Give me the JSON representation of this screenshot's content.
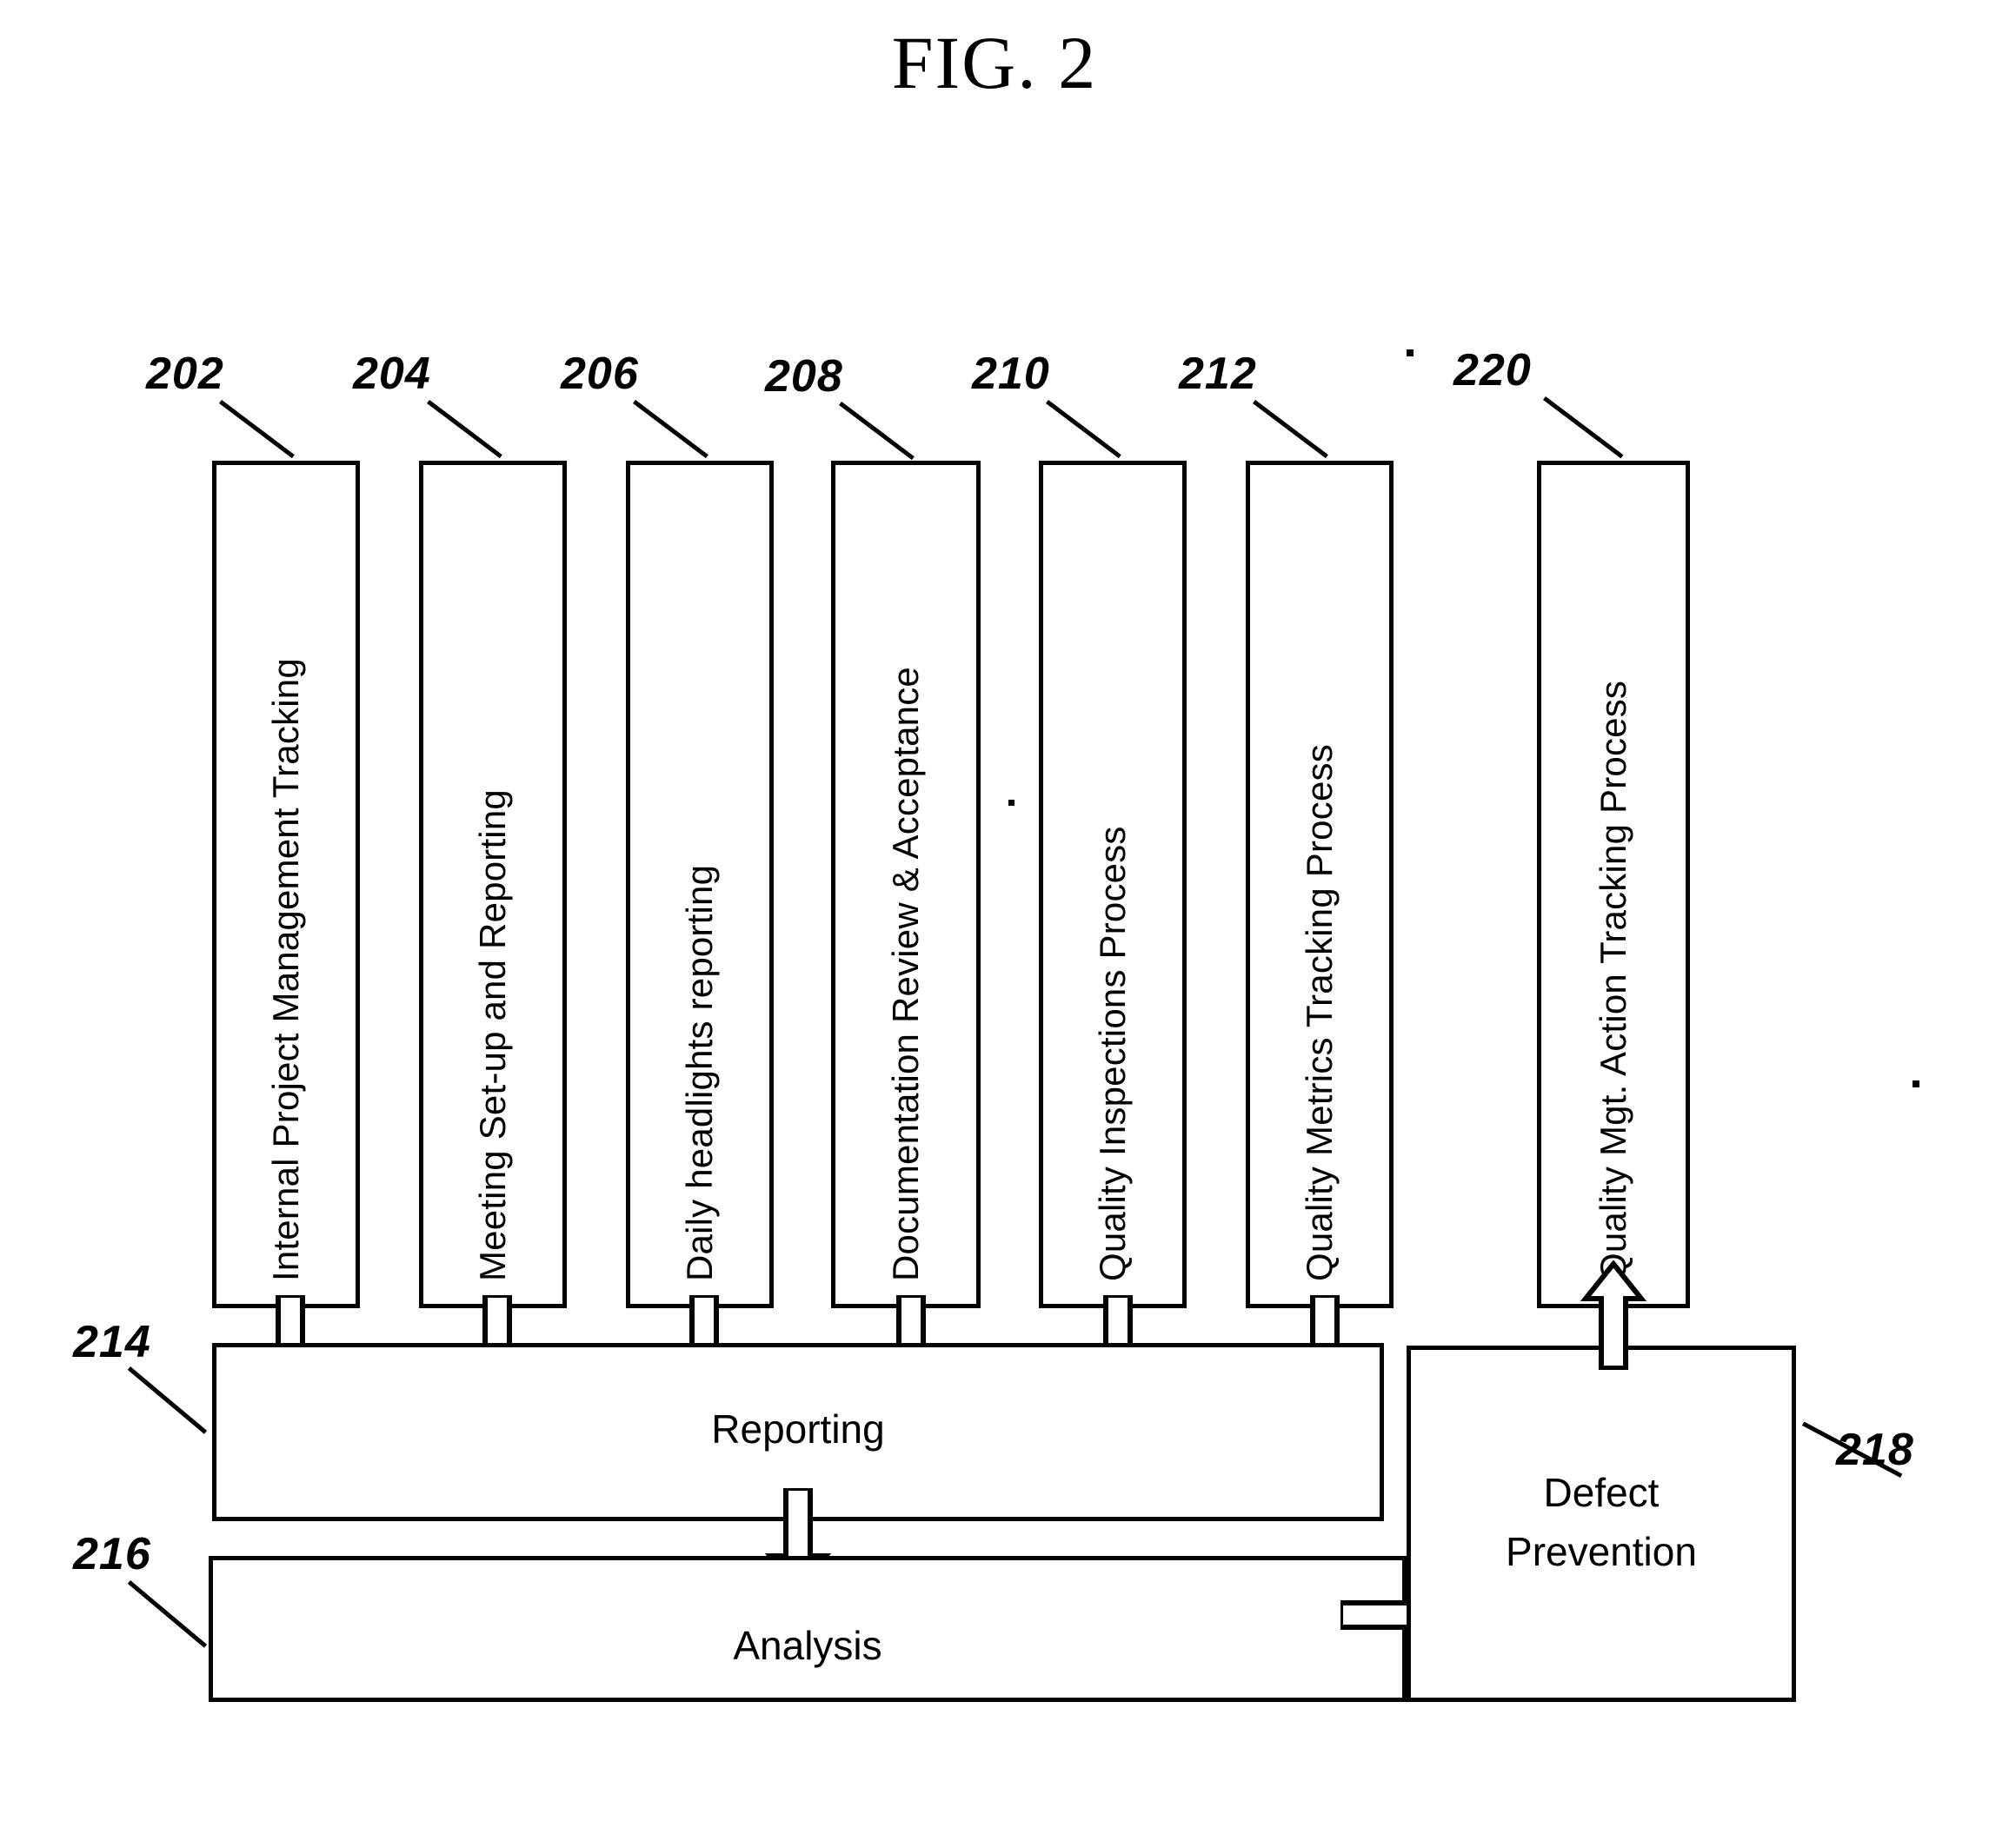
{
  "figure": {
    "title": "FIG. 2",
    "type": "patent-flow-diagram"
  },
  "process_boxes": [
    {
      "ref": "202",
      "label": "Internal Project Management Tracking"
    },
    {
      "ref": "204",
      "label": "Meeting Set-up and Reporting"
    },
    {
      "ref": "206",
      "label": "Daily headlights reporting"
    },
    {
      "ref": "208",
      "label": "Documentation Review & Acceptance"
    },
    {
      "ref": "210",
      "label": "Quality Inspections Process"
    },
    {
      "ref": "212",
      "label": "Quality Metrics Tracking Process"
    },
    {
      "ref": "220",
      "label": "Quality Mgt. Action Tracking Process"
    }
  ],
  "stage_boxes": [
    {
      "ref": "214",
      "label": "Reporting"
    },
    {
      "ref": "216",
      "label": "Analysis"
    },
    {
      "ref": "218",
      "label": "Defect\nPrevention"
    }
  ],
  "defect_prevention": {
    "line1": "Defect",
    "line2": "Prevention"
  },
  "refs": {
    "r202": "202",
    "r204": "204",
    "r206": "206",
    "r208": "208",
    "r210": "210",
    "r212": "212",
    "r214": "214",
    "r216": "216",
    "r218": "218",
    "r220": "220"
  },
  "labels": {
    "l202": "Internal Project Management Tracking",
    "l204": "Meeting Set-up and Reporting",
    "l206": "Daily headlights reporting",
    "l208": "Documentation Review & Acceptance",
    "l210": "Quality Inspections Process",
    "l212": "Quality Metrics Tracking Process",
    "l220": "Quality Mgt. Action Tracking Process",
    "reporting": "Reporting",
    "analysis": "Analysis"
  },
  "colors": {
    "stroke": "#000000",
    "fill": "#ffffff"
  }
}
